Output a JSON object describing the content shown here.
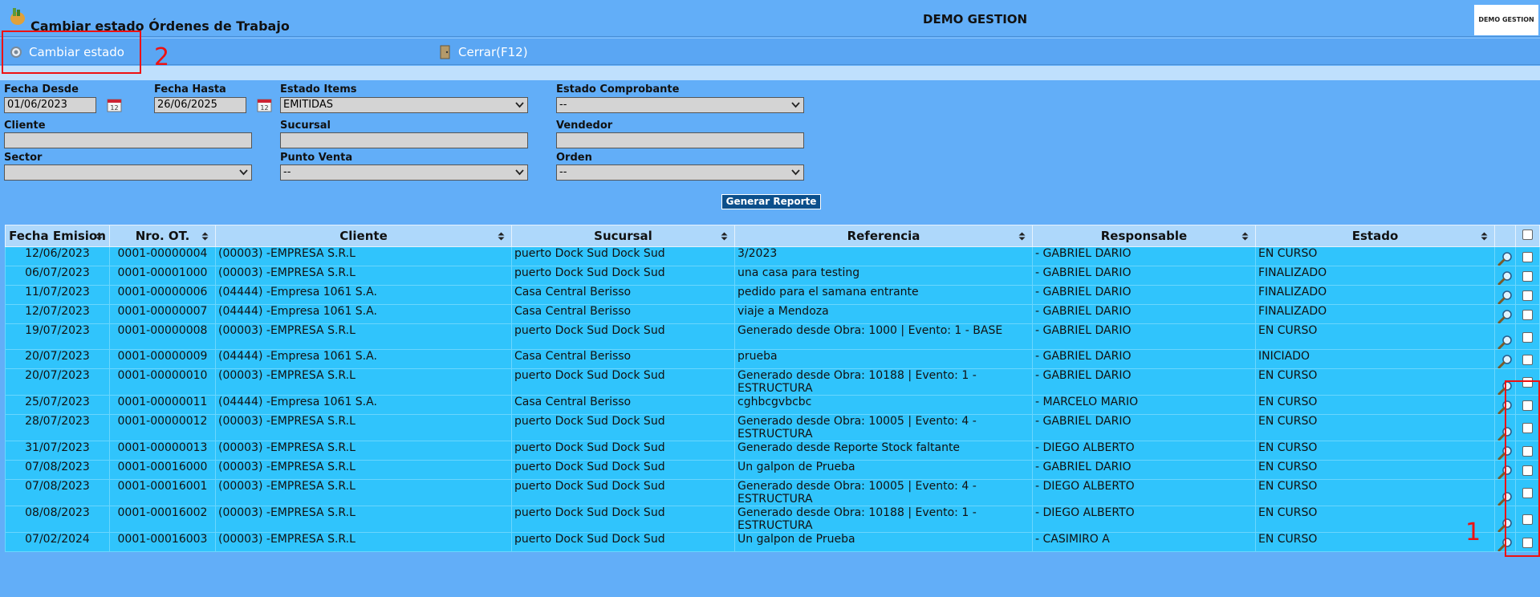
{
  "window": {
    "title": "Cambiar estado Órdenes de Trabajo",
    "company": "DEMO GESTION",
    "corner_logo": "DEMO GESTION"
  },
  "toolbar": {
    "change_state_label": "Cambiar estado",
    "close_label": "Cerrar(F12)"
  },
  "filters": {
    "fecha_desde": {
      "label": "Fecha Desde",
      "value": "01/06/2023"
    },
    "fecha_hasta": {
      "label": "Fecha Hasta",
      "value": "26/06/2025"
    },
    "estado_items": {
      "label": "Estado Items",
      "value": "EMITIDAS"
    },
    "estado_comprobante": {
      "label": "Estado Comprobante",
      "value": "--"
    },
    "cliente": {
      "label": "Cliente",
      "value": ""
    },
    "sucursal": {
      "label": "Sucursal",
      "value": ""
    },
    "vendedor": {
      "label": "Vendedor",
      "value": ""
    },
    "sector": {
      "label": "Sector",
      "value": ""
    },
    "punto_venta": {
      "label": "Punto Venta",
      "value": "--"
    },
    "orden": {
      "label": "Orden",
      "value": "--"
    }
  },
  "generate_label": "Generar Reporte",
  "table": {
    "headers": [
      "Fecha Emision",
      "Nro. OT.",
      "Cliente",
      "Sucursal",
      "Referencia",
      "Responsable",
      "Estado"
    ],
    "rows": [
      [
        "12/06/2023",
        "0001-00000004",
        "(00003) -EMPRESA S.R.L",
        "puerto Dock Sud Dock Sud",
        "3/2023",
        "- GABRIEL DARIO",
        "EN CURSO"
      ],
      [
        "06/07/2023",
        "0001-00001000",
        "(00003) -EMPRESA S.R.L",
        "puerto Dock Sud Dock Sud",
        "una casa para testing",
        "- GABRIEL DARIO",
        "FINALIZADO"
      ],
      [
        "11/07/2023",
        "0001-00000006",
        "(04444) -Empresa 1061 S.A.",
        "Casa Central Berisso",
        "pedido para el samana entrante",
        "- GABRIEL DARIO",
        "FINALIZADO"
      ],
      [
        "12/07/2023",
        "0001-00000007",
        "(04444) -Empresa 1061 S.A.",
        "Casa Central Berisso",
        "viaje a Mendoza",
        "- GABRIEL DARIO",
        "FINALIZADO"
      ],
      [
        "19/07/2023",
        "0001-00000008",
        "(00003) -EMPRESA S.R.L",
        "puerto Dock Sud Dock Sud",
        "Generado desde Obra: 1000 | Evento: 1 - BASE",
        "- GABRIEL DARIO",
        "EN CURSO"
      ],
      [
        "20/07/2023",
        "0001-00000009",
        "(04444) -Empresa 1061 S.A.",
        "Casa Central Berisso",
        "prueba",
        "- GABRIEL DARIO",
        "INICIADO"
      ],
      [
        "20/07/2023",
        "0001-00000010",
        "(00003) -EMPRESA S.R.L",
        "puerto Dock Sud Dock Sud",
        "Generado desde Obra: 10188 | Evento: 1 - ESTRUCTURA",
        "- GABRIEL DARIO",
        "EN CURSO"
      ],
      [
        "25/07/2023",
        "0001-00000011",
        "(04444) -Empresa 1061 S.A.",
        "Casa Central Berisso",
        "cghbcgvbcbc",
        "- MARCELO MARIO",
        "EN CURSO"
      ],
      [
        "28/07/2023",
        "0001-00000012",
        "(00003) -EMPRESA S.R.L",
        "puerto Dock Sud Dock Sud",
        "Generado desde Obra: 10005 | Evento: 4 - ESTRUCTURA",
        "- GABRIEL DARIO",
        "EN CURSO"
      ],
      [
        "31/07/2023",
        "0001-00000013",
        "(00003) -EMPRESA S.R.L",
        "puerto Dock Sud Dock Sud",
        "Generado desde Reporte Stock faltante",
        "- DIEGO ALBERTO",
        "EN CURSO"
      ],
      [
        "07/08/2023",
        "0001-00016000",
        "(00003) -EMPRESA S.R.L",
        "puerto Dock Sud Dock Sud",
        "Un galpon de Prueba",
        "- GABRIEL DARIO",
        "EN CURSO"
      ],
      [
        "07/08/2023",
        "0001-00016001",
        "(00003) -EMPRESA S.R.L",
        "puerto Dock Sud Dock Sud",
        "Generado desde Obra: 10005 | Evento: 4 - ESTRUCTURA",
        "- DIEGO ALBERTO",
        "EN CURSO"
      ],
      [
        "08/08/2023",
        "0001-00016002",
        "(00003) -EMPRESA S.R.L",
        "puerto Dock Sud Dock Sud",
        "Generado desde Obra: 10188 | Evento: 1 - ESTRUCTURA",
        "- DIEGO ALBERTO",
        "EN CURSO"
      ],
      [
        "07/02/2024",
        "0001-00016003",
        "(00003) -EMPRESA S.R.L",
        "puerto Dock Sud Dock Sud",
        "Un galpon de Prueba",
        "- CASIMIRO A",
        "EN CURSO"
      ]
    ]
  },
  "annotations": {
    "label_1": "1",
    "label_2": "2",
    "color": "#e11111"
  },
  "icons": {
    "row_action": "magnifier-icon",
    "toolbar_change": "gear-icon",
    "toolbar_close": "door-icon",
    "date": "calendar-icon"
  }
}
